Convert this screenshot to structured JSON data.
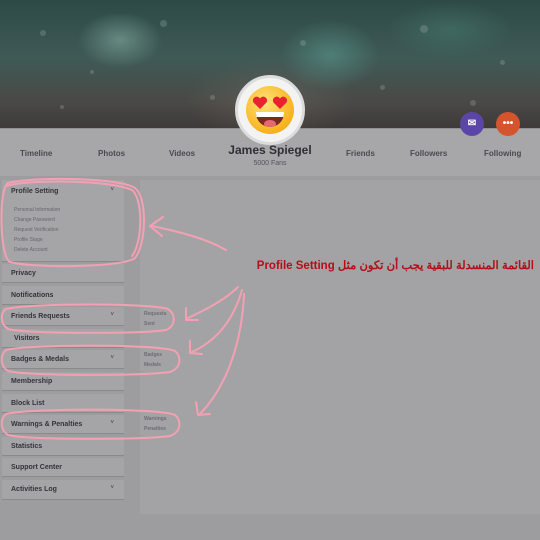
{
  "header": {
    "profile_name": "James Spiegel",
    "fans": "5000 Fans",
    "nav_left": [
      "Timeline",
      "Photos",
      "Videos"
    ],
    "nav_right": [
      "Friends",
      "Followers",
      "Following"
    ],
    "message_icon": "chat-icon",
    "more_icon": "more-dots-icon",
    "more_glyph": "•••",
    "message_glyph": "✉"
  },
  "sidebar": {
    "items": [
      {
        "label": "Profile Setting",
        "chevron": "˅"
      },
      {
        "label": "Privacy"
      },
      {
        "label": "Notifications"
      },
      {
        "label": "Friends Requests",
        "chevron": "˅"
      },
      {
        "label": "Visitors"
      },
      {
        "label": "Badges & Medals",
        "chevron": "˅"
      },
      {
        "label": "Membership"
      },
      {
        "label": "Block List"
      },
      {
        "label": "Warnings & Penalties",
        "chevron": "˅"
      },
      {
        "label": "Statistics"
      },
      {
        "label": "Support Center"
      },
      {
        "label": "Activities Log",
        "chevron": "˅"
      }
    ],
    "profile_submenu": [
      "Personal Information",
      "Change Password",
      "Request Verification",
      "Profile Stage",
      "Delete Account"
    ]
  },
  "content": {
    "friends_sub": [
      "Requests",
      "Sent"
    ],
    "badges_sub": [
      "Badges",
      "Medals"
    ],
    "warnings_sub": [
      "Warnings",
      "Penalties"
    ]
  },
  "annotation": {
    "text": "القائمة المنسدلة للبقية يجب أن تكون مثل Profile Setting"
  },
  "colors": {
    "accent_purple": "#5b45a8",
    "accent_orange": "#d5542d",
    "annotation_red": "#b30f16",
    "highlight_pink": "#f3a0b3"
  }
}
